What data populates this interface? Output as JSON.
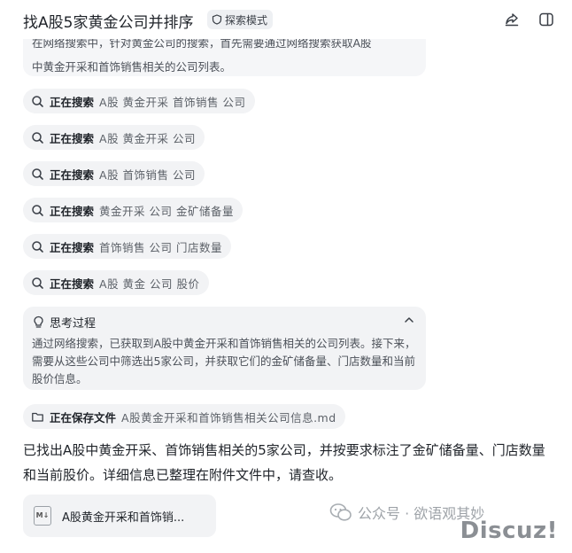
{
  "header": {
    "title": "找A股5家黄金公司并排序",
    "mode_badge": "探索模式"
  },
  "prior_message": {
    "partial_line1": "在网络搜索中，针对黄金公司的搜索，首先需要通过网络搜索获取A股",
    "partial_line2": "中黄金开采和首饰销售相关的公司列表。"
  },
  "steps": [
    {
      "status": "正在搜索",
      "query": "A股 黄金开采 首饰销售 公司",
      "icon": "search-icon"
    },
    {
      "status": "正在搜索",
      "query": "A股 黄金开采 公司",
      "icon": "search-icon"
    },
    {
      "status": "正在搜索",
      "query": "A股 首饰销售 公司",
      "icon": "search-icon"
    },
    {
      "status": "正在搜索",
      "query": "黄金开采 公司 金矿储备量",
      "icon": "search-icon"
    },
    {
      "status": "正在搜索",
      "query": "首饰销售 公司 门店数量",
      "icon": "search-icon"
    },
    {
      "status": "正在搜索",
      "query": "A股 黄金 公司 股价",
      "icon": "search-icon"
    }
  ],
  "thinking": {
    "title": "思考过程",
    "body": "通过网络搜索，已获取到A股中黄金开采和首饰销售相关的公司列表。接下来，需要从这些公司中筛选出5家公司，并获取它们的金矿储备量、门店数量和当前股价信息。"
  },
  "save_step": {
    "status": "正在保存文件",
    "filename": "A股黄金开采和首饰销售相关公司信息.md",
    "icon": "folder-icon"
  },
  "answer": "已找出A股中黄金开采、首饰销售相关的5家公司，并按要求标注了金矿储备量、门店数量和当前股价。详细信息已整理在附件文件中，请查收。",
  "attachment": {
    "name": "A股黄金开采和首饰销...",
    "type_label": "M↓"
  },
  "watermark": {
    "text": "公众号 · 欲语观其妙",
    "brand": "Discuz!"
  }
}
